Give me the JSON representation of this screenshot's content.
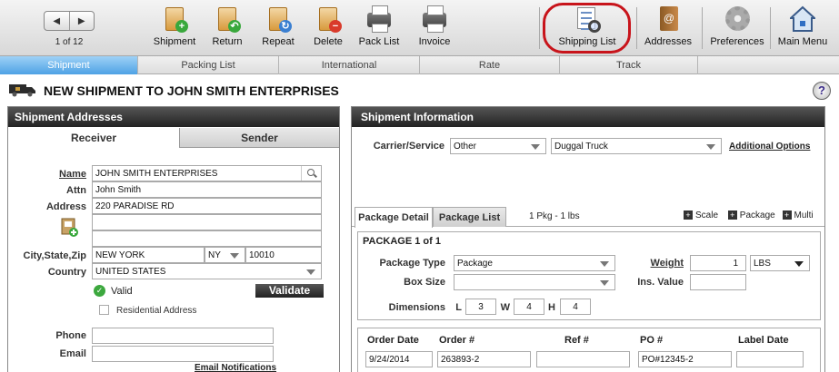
{
  "toolbar": {
    "page_count": "1 of 12",
    "buttons": [
      {
        "label": "Shipment"
      },
      {
        "label": "Return"
      },
      {
        "label": "Repeat"
      },
      {
        "label": "Delete"
      },
      {
        "label": "Pack List"
      },
      {
        "label": "Invoice"
      },
      {
        "label": "Shipping List"
      },
      {
        "label": "Addresses"
      },
      {
        "label": "Preferences"
      },
      {
        "label": "Main Menu"
      }
    ],
    "highlight_color": "#c8141b"
  },
  "tabs": [
    {
      "label": "Shipment",
      "active": true
    },
    {
      "label": "Packing List"
    },
    {
      "label": "International"
    },
    {
      "label": "Rate"
    },
    {
      "label": "Track"
    }
  ],
  "page_title": "NEW SHIPMENT TO JOHN SMITH ENTERPRISES",
  "help_label": "?",
  "addresses": {
    "header": "Shipment Addresses",
    "tabs": {
      "receiver": "Receiver",
      "sender": "Sender"
    },
    "labels": {
      "name": "Name",
      "attn": "Attn",
      "address": "Address",
      "city": "City,State,Zip",
      "country": "Country",
      "phone": "Phone",
      "email": "Email"
    },
    "values": {
      "name": "JOHN SMITH ENTERPRISES",
      "attn": "John Smith",
      "address1": "220 PARADISE RD",
      "address2": "",
      "address3": "",
      "city": "NEW YORK",
      "state": "NY",
      "zip": "10010",
      "country": "UNITED STATES",
      "phone": "",
      "email": ""
    },
    "valid_label": "Valid",
    "validate_button": "Validate",
    "residential_label": "Residential Address",
    "email_notifications": "Email Notifications"
  },
  "shipment_info": {
    "header": "Shipment Information",
    "carrier_label": "Carrier/Service",
    "carrier": "Other",
    "service": "Duggal Truck",
    "additional_options": "Additional Options",
    "pkg_tabs": {
      "detail": "Package Detail",
      "list": "Package List"
    },
    "pkg_summary": "1 Pkg - 1 lbs",
    "actions": {
      "scale": "Scale",
      "package": "Package",
      "multi": "Multi"
    },
    "package_header": "PACKAGE 1 of 1",
    "labels": {
      "package_type": "Package Type",
      "box_size": "Box Size",
      "dimensions": "Dimensions",
      "weight": "Weight",
      "ins_value": "Ins. Value",
      "l": "L",
      "w": "W",
      "h": "H"
    },
    "values": {
      "package_type": "Package",
      "box_size": "",
      "l": "3",
      "w": "4",
      "h": "4",
      "weight": "1",
      "weight_unit": "LBS",
      "ins_value": ""
    },
    "order_labels": {
      "order_date": "Order Date",
      "order_num": "Order #",
      "ref_num": "Ref #",
      "po_num": "PO #",
      "label_date": "Label Date"
    },
    "order_values": {
      "order_date": "9/24/2014",
      "order_num": "263893-2",
      "ref_num": "",
      "po_num": "PO#12345-2",
      "label_date": ""
    }
  }
}
